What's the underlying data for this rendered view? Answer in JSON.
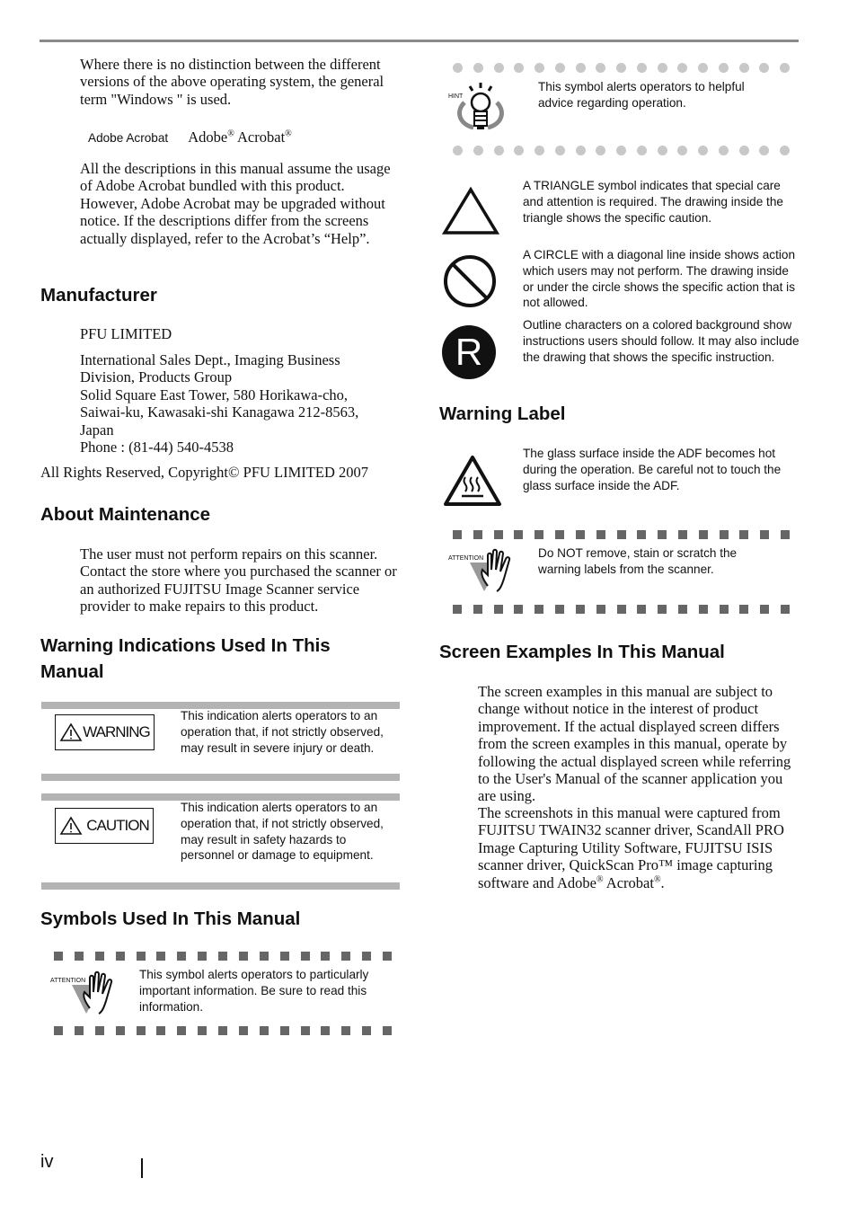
{
  "page": {
    "page_number": "iv"
  },
  "left": {
    "intro_para": "Where there is no distinction between the different versions of the above operating system, the general term \"Windows \" is used.",
    "acrobat_term": {
      "label": "Adobe Acrobat",
      "full_name_a": "Adobe",
      "full_name_b": "Acrobat",
      "reg_mark": "®"
    },
    "acrobat_para": "All the descriptions in this manual assume the usage of Adobe Acrobat bundled with this product. However, Adobe Acrobat may be upgraded without notice. If the descriptions differ from the screens actually displayed, refer to the Acrobat’s “Help”.",
    "manufacturer": {
      "heading": "Manufacturer",
      "company": "PFU LIMITED",
      "address_lines": [
        "International Sales Dept., Imaging Business",
        "Division, Products Group",
        "Solid Square East Tower, 580 Horikawa-cho,",
        "Saiwai-ku, Kawasaki-shi Kanagawa 212-8563,",
        "Japan",
        "Phone : (81-44) 540-4538"
      ],
      "copyright": "All Rights Reserved, Copyright© PFU LIMITED 2007"
    },
    "maintenance": {
      "heading": "About Maintenance",
      "text": "The user must not perform repairs on this scanner. Contact the store where you purchased the scanner or an authorized FUJITSU Image Scanner service provider to make repairs to this product."
    },
    "warning_indications": {
      "heading_line1": "Warning Indications Used In This",
      "heading_line2": "Manual",
      "items": [
        {
          "label": "WARNING",
          "text": "This indication alerts operators to an operation that, if not strictly observed, may result in severe injury or death."
        },
        {
          "label": "CAUTION",
          "text": "This indication alerts operators to an operation that, if not strictly observed, may result in safety hazards to personnel or damage to equipment."
        }
      ]
    },
    "symbols": {
      "heading": "Symbols Used In This Manual",
      "attention_label": "ATTENTION",
      "attention_text": "This symbol alerts operators to particularly important information. Be sure to read this information."
    }
  },
  "right": {
    "hint": {
      "label": "HINT",
      "text": "This symbol alerts operators to helpful advice regarding operation."
    },
    "symbol_items": [
      {
        "icon": "triangle-icon",
        "text": "A TRIANGLE symbol indicates that special care and attention is required. The drawing inside the triangle shows the specific caution."
      },
      {
        "icon": "prohibited-icon",
        "text": "A CIRCLE with a diagonal line inside shows action which users may not perform. The drawing inside or under the circle shows the specific action that is not allowed."
      },
      {
        "icon": "instruction-r-icon",
        "glyph": "R",
        "text": "Outline characters on a colored background show instructions users should follow. It may also include the drawing that shows the specific instruction."
      }
    ],
    "warning_label": {
      "heading": "Warning Label",
      "hot_text": "The glass surface inside the ADF becomes hot during the operation. Be careful not to touch the glass surface inside the ADF.",
      "attention_label": "ATTENTION",
      "attention_text": "Do NOT remove, stain or scratch the warning labels from the scanner."
    },
    "screen_examples": {
      "heading": "Screen Examples In This Manual",
      "para1": "The screen examples in this manual are subject to change without notice in the interest of product improvement. If the actual displayed screen differs from the screen examples in this manual, operate by following the actual displayed screen while referring to the User's Manual of the scanner application you are using.",
      "para2_main": "The screenshots in this manual were captured from FUJITSU TWAIN32 scanner driver, ScandAll PRO Image Capturing Utility Software, FUJITSU ISIS scanner driver, QuickScan Pro™ image capturing software and Adobe",
      "para2_mid": " Acrobat",
      "para2_end": ".",
      "reg_mark": "®"
    }
  }
}
